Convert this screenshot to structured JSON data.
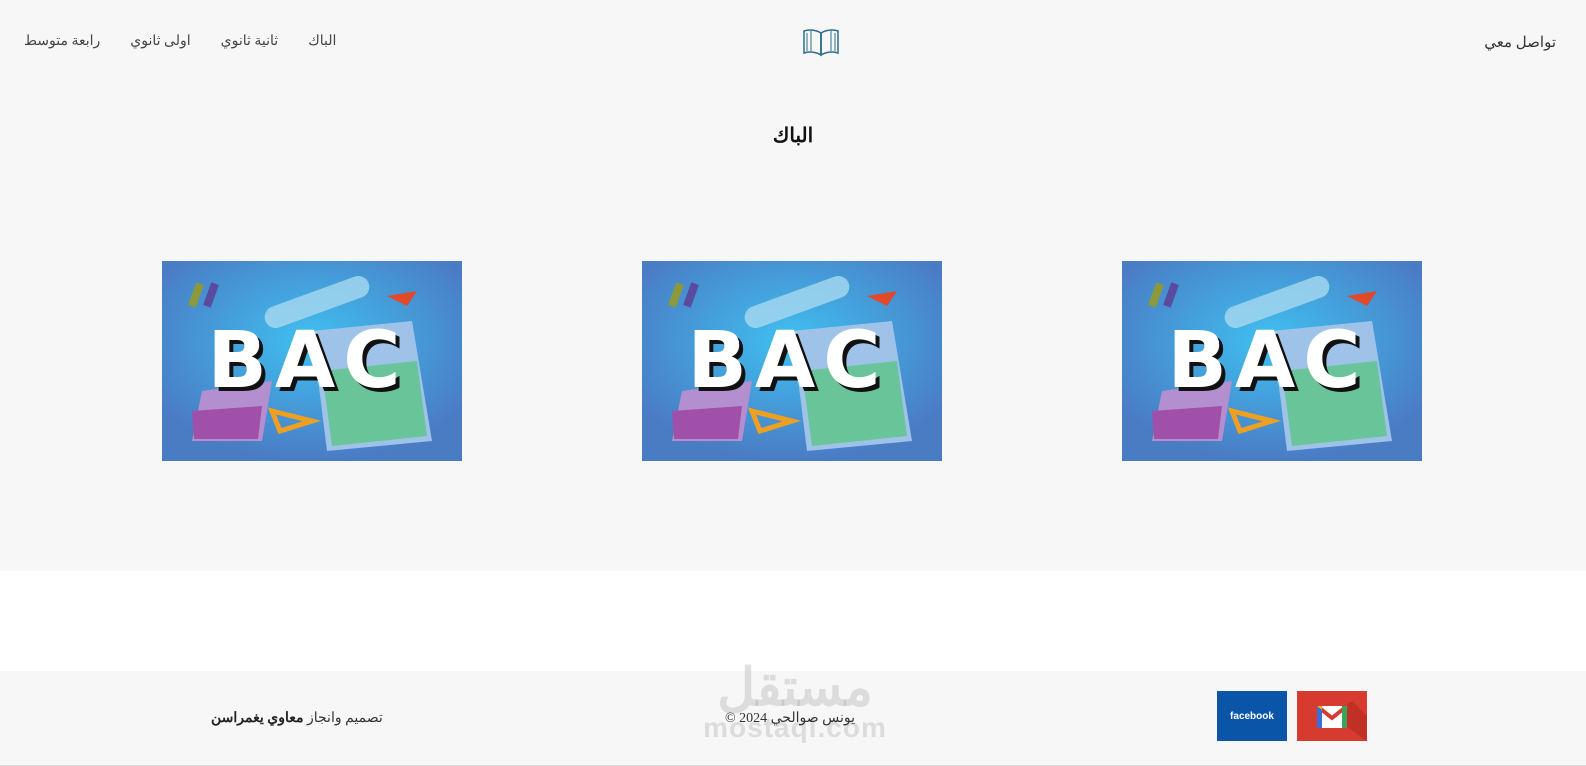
{
  "header": {
    "contact_label": "تواصل معي",
    "logo_icon": "open-book-icon",
    "nav": [
      {
        "label": "رابعة متوسط"
      },
      {
        "label": "اولى ثانوي"
      },
      {
        "label": "ثانية ثانوي"
      },
      {
        "label": "الباك"
      }
    ]
  },
  "main": {
    "title": "الباك",
    "cards": [
      {
        "image_text": "BAC"
      },
      {
        "image_text": "BAC"
      },
      {
        "image_text": "BAC"
      }
    ]
  },
  "footer": {
    "credit_prefix": "تصميم وانجاز",
    "credit_name": "معاوي يغمراسن",
    "copyright": "يونس صوالحي 2024 ©",
    "facebook_label": "facebook",
    "gmail_icon": "gmail-icon",
    "watermark_ar": "مستقل",
    "watermark_en": "mostaql.com"
  },
  "colors": {
    "page_bg": "#f7f7f7",
    "card_bg": "#4a7cc4",
    "facebook": "#0a55a7",
    "gmail": "#d73a2f"
  }
}
